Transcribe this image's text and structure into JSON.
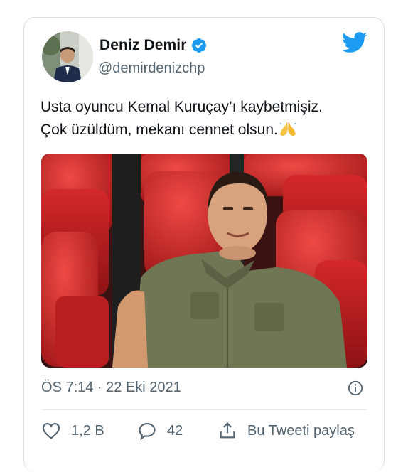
{
  "author": {
    "display_name": "Deniz Demir",
    "handle": "@demirdenizchp",
    "verified": true
  },
  "tweet": {
    "line1": "Usta oyuncu Kemal Kuruçay’ı kaybetmişiz.",
    "line2": "Çok üzüldüm, mekanı cennet olsun.",
    "emoji": "folded-hands",
    "timestamp": "ÖS 7:14 · 22 Eki 2021"
  },
  "stats": {
    "likes": "1,2 B",
    "replies": "42",
    "share_label": "Bu Tweeti paylaş"
  },
  "colors": {
    "brand": "#1d9bf0",
    "text": "#0f1419",
    "secondary": "#536471",
    "border": "#d9dee2"
  }
}
